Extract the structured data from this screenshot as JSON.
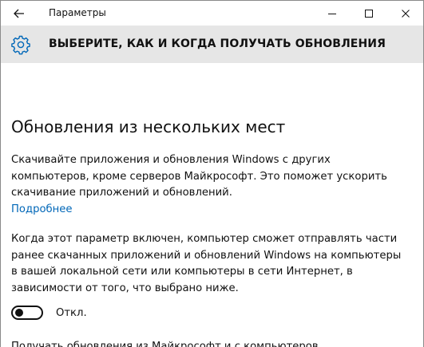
{
  "window": {
    "title": "Параметры",
    "back_icon": "arrow-left-icon",
    "minimize_icon": "minimize-icon",
    "maximize_icon": "maximize-icon",
    "close_icon": "close-icon"
  },
  "header": {
    "icon": "gear-icon",
    "title": "ВЫБЕРИТЕ, КАК И КОГДА ПОЛУЧАТЬ ОБНОВЛЕНИЯ",
    "band_color": "#e6e6e6",
    "icon_color": "#0067b8"
  },
  "main": {
    "section_title": "Обновления из нескольких мест",
    "paragraph1": "Скачивайте приложения и обновления Windows с других компьютеров, кроме серверов Майкрософт. Это поможет ускорить скачивание приложений и обновлений.",
    "learn_more_link": "Подробнее",
    "paragraph2": "Когда этот параметр включен, компьютер сможет отправлять части ранее скачанных приложений и обновлений Windows на компьютеры в вашей локальной сети или компьютеры в сети Интернет, в зависимости от того, что выбрано ниже.",
    "toggle": {
      "state_label": "Откл.",
      "on": false
    },
    "cut_off_text": "Получать обновления из Майкрософт и с компьютеров"
  },
  "colors": {
    "link": "#0067b8",
    "text": "#111111",
    "background": "#ffffff"
  }
}
